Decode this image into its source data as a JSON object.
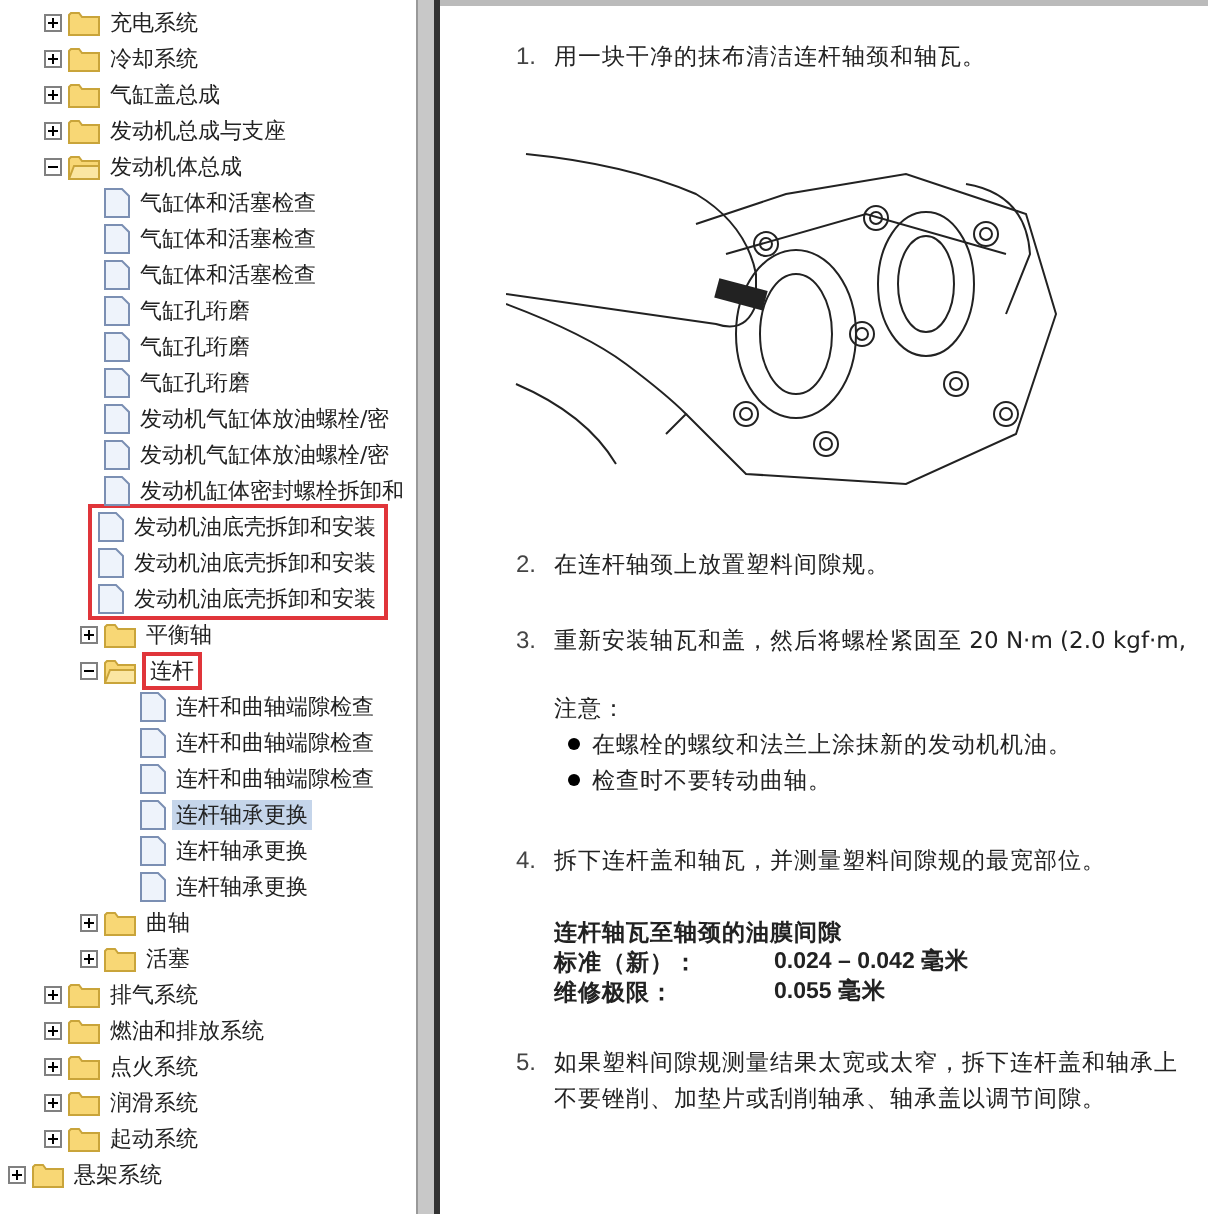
{
  "tree": {
    "branch": [
      {
        "label": "充电系统",
        "kind": "folder",
        "expanded": false,
        "selected": false,
        "marked": false
      },
      {
        "label": "冷却系统",
        "kind": "folder",
        "expanded": false,
        "selected": false,
        "marked": false
      },
      {
        "label": "气缸盖总成",
        "kind": "folder",
        "expanded": false,
        "selected": false,
        "marked": false
      },
      {
        "label": "发动机总成与支座",
        "kind": "folder",
        "expanded": false,
        "selected": false,
        "marked": false
      },
      {
        "label": "发动机体总成",
        "kind": "folder",
        "expanded": true,
        "selected": false,
        "marked": false,
        "children": [
          {
            "label": "气缸体和活塞检查",
            "kind": "page",
            "selected": false,
            "marked": false
          },
          {
            "label": "气缸体和活塞检查",
            "kind": "page",
            "selected": false,
            "marked": false
          },
          {
            "label": "气缸体和活塞检查",
            "kind": "page",
            "selected": false,
            "marked": false
          },
          {
            "label": "气缸孔珩磨",
            "kind": "page",
            "selected": false,
            "marked": false
          },
          {
            "label": "气缸孔珩磨",
            "kind": "page",
            "selected": false,
            "marked": false
          },
          {
            "label": "气缸孔珩磨",
            "kind": "page",
            "selected": false,
            "marked": false
          },
          {
            "label": "发动机气缸体放油螺栓/密",
            "kind": "page",
            "selected": false,
            "marked": false
          },
          {
            "label": "发动机气缸体放油螺栓/密",
            "kind": "page",
            "selected": false,
            "marked": false
          },
          {
            "label": "发动机缸体密封螺栓拆卸和",
            "kind": "page",
            "selected": false,
            "marked": false
          },
          {
            "label": "发动机油底壳拆卸和安装",
            "kind": "page",
            "selected": false,
            "marked": true
          },
          {
            "label": "发动机油底壳拆卸和安装",
            "kind": "page",
            "selected": false,
            "marked": true
          },
          {
            "label": "发动机油底壳拆卸和安装",
            "kind": "page",
            "selected": false,
            "marked": true
          },
          {
            "label": "平衡轴",
            "kind": "folder",
            "expanded": false,
            "selected": false,
            "marked": false
          },
          {
            "label": "连杆",
            "kind": "folder",
            "expanded": true,
            "selected": false,
            "marked": true,
            "children": [
              {
                "label": "连杆和曲轴端隙检查",
                "kind": "page",
                "selected": false,
                "marked": false
              },
              {
                "label": "连杆和曲轴端隙检查",
                "kind": "page",
                "selected": false,
                "marked": false
              },
              {
                "label": "连杆和曲轴端隙检查",
                "kind": "page",
                "selected": false,
                "marked": false
              },
              {
                "label": "连杆轴承更换",
                "kind": "page",
                "selected": true,
                "marked": false
              },
              {
                "label": "连杆轴承更换",
                "kind": "page",
                "selected": false,
                "marked": false
              },
              {
                "label": "连杆轴承更换",
                "kind": "page",
                "selected": false,
                "marked": false
              }
            ]
          },
          {
            "label": "曲轴",
            "kind": "folder",
            "expanded": false,
            "selected": false,
            "marked": false
          },
          {
            "label": "活塞",
            "kind": "folder",
            "expanded": false,
            "selected": false,
            "marked": false
          }
        ]
      },
      {
        "label": "排气系统",
        "kind": "folder",
        "expanded": false,
        "selected": false,
        "marked": false
      },
      {
        "label": "燃油和排放系统",
        "kind": "folder",
        "expanded": false,
        "selected": false,
        "marked": false
      },
      {
        "label": "点火系统",
        "kind": "folder",
        "expanded": false,
        "selected": false,
        "marked": false
      },
      {
        "label": "润滑系统",
        "kind": "folder",
        "expanded": false,
        "selected": false,
        "marked": false
      },
      {
        "label": "起动系统",
        "kind": "folder",
        "expanded": false,
        "selected": false,
        "marked": false
      }
    ],
    "siblings": [
      {
        "label": "悬架系统",
        "kind": "folder",
        "expanded": false,
        "selected": false,
        "marked": false
      }
    ]
  },
  "content": [
    {
      "kind": "step",
      "number": "1.",
      "lines": [
        "用一块干净的抹布清洁连杆轴颈和轴瓦。"
      ]
    },
    {
      "kind": "figure"
    },
    {
      "kind": "step",
      "number": "2.",
      "lines": [
        "在连杆轴颈上放置塑料间隙规。"
      ]
    },
    {
      "kind": "step",
      "number": "3.",
      "lines": [
        "重新安装轴瓦和盖，然后将螺栓紧固至 20 N·m (2.0 kgf·m,"
      ]
    },
    {
      "kind": "note",
      "title": "注意：",
      "bullets": [
        "在螺栓的螺纹和法兰上涂抹新的发动机机油。",
        "检查时不要转动曲轴。"
      ]
    },
    {
      "kind": "step",
      "number": "4.",
      "lines": [
        "拆下连杆盖和轴瓦，并测量塑料间隙规的最宽部位。"
      ]
    },
    {
      "kind": "spec",
      "title": "连杆轴瓦至轴颈的油膜间隙",
      "rows": [
        {
          "label": "标准（新）：",
          "value": "0.024 – 0.042 毫米"
        },
        {
          "label": "维修极限：",
          "value": "0.055 毫米"
        }
      ]
    },
    {
      "kind": "step",
      "number": "5.",
      "lines": [
        "如果塑料间隙规测量结果太宽或太窄，拆下连杆盖和轴承上",
        "不要锉削、加垫片或刮削轴承、轴承盖以调节间隙。"
      ]
    }
  ]
}
